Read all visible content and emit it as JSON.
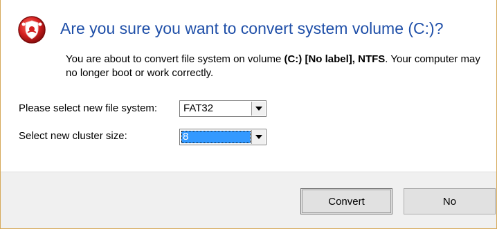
{
  "dialog": {
    "title": "Are you sure you want to convert system volume (C:)?",
    "message_prefix": "You are about to convert file system on volume ",
    "message_bold": "(C:) [No label], NTFS",
    "message_suffix": ". Your computer may no longer boot or work correctly.",
    "icon": "warning-shield-icon",
    "icon_color": "#d92020"
  },
  "form": {
    "file_system_label": "Please select new file system:",
    "file_system_value": "FAT32",
    "cluster_size_label": "Select new cluster size:",
    "cluster_size_value": "8"
  },
  "buttons": {
    "convert_label": "Convert",
    "no_label": "No"
  },
  "colors": {
    "title": "#1f4fa8",
    "selection": "#3399ff",
    "footer": "#f0f0f0"
  }
}
